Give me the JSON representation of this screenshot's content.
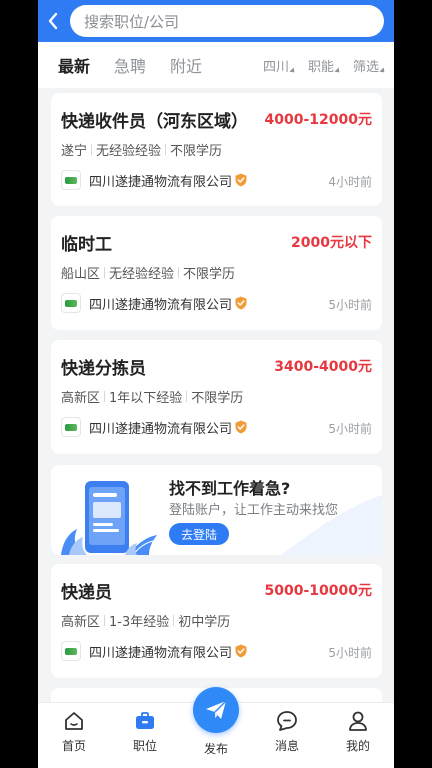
{
  "search": {
    "placeholder": "搜索职位/公司"
  },
  "tabs": [
    {
      "label": "最新",
      "active": true
    },
    {
      "label": "急聘",
      "active": false
    },
    {
      "label": "附近",
      "active": false
    }
  ],
  "filters": [
    {
      "label": "四川"
    },
    {
      "label": "职能"
    },
    {
      "label": "筛选"
    }
  ],
  "jobs": [
    {
      "title": "快递收件员（河东区域）",
      "salary": "4000-12000元",
      "tags": [
        "遂宁",
        "无经验经验",
        "不限学历"
      ],
      "company": "四川遂捷通物流有限公司",
      "time": "4小时前"
    },
    {
      "title": "临时工",
      "salary": "2000元以下",
      "tags": [
        "船山区",
        "无经验经验",
        "不限学历"
      ],
      "company": "四川遂捷通物流有限公司",
      "time": "5小时前"
    },
    {
      "title": "快递分拣员",
      "salary": "3400-4000元",
      "tags": [
        "高新区",
        "1年以下经验",
        "不限学历"
      ],
      "company": "四川遂捷通物流有限公司",
      "time": "5小时前"
    },
    {
      "title": "快递员",
      "salary": "5000-10000元",
      "tags": [
        "高新区",
        "1-3年经验",
        "初中学历"
      ],
      "company": "四川遂捷通物流有限公司",
      "time": "5小时前"
    }
  ],
  "banner": {
    "title": "找不到工作着急?",
    "subtitle": "登陆账户，让工作主动来找您",
    "button": "去登陆"
  },
  "nav": [
    {
      "label": "首页",
      "icon": "home-icon",
      "active": false
    },
    {
      "label": "职位",
      "icon": "briefcase-icon",
      "active": true
    },
    {
      "label": "发布",
      "icon": "paper-plane-icon",
      "active": false
    },
    {
      "label": "消息",
      "icon": "chat-bubble-icon",
      "active": false
    },
    {
      "label": "我的",
      "icon": "user-icon",
      "active": false
    }
  ],
  "colors": {
    "brand": "#2f7bf4",
    "salary": "#e7373f",
    "verified": "#f29c38"
  }
}
